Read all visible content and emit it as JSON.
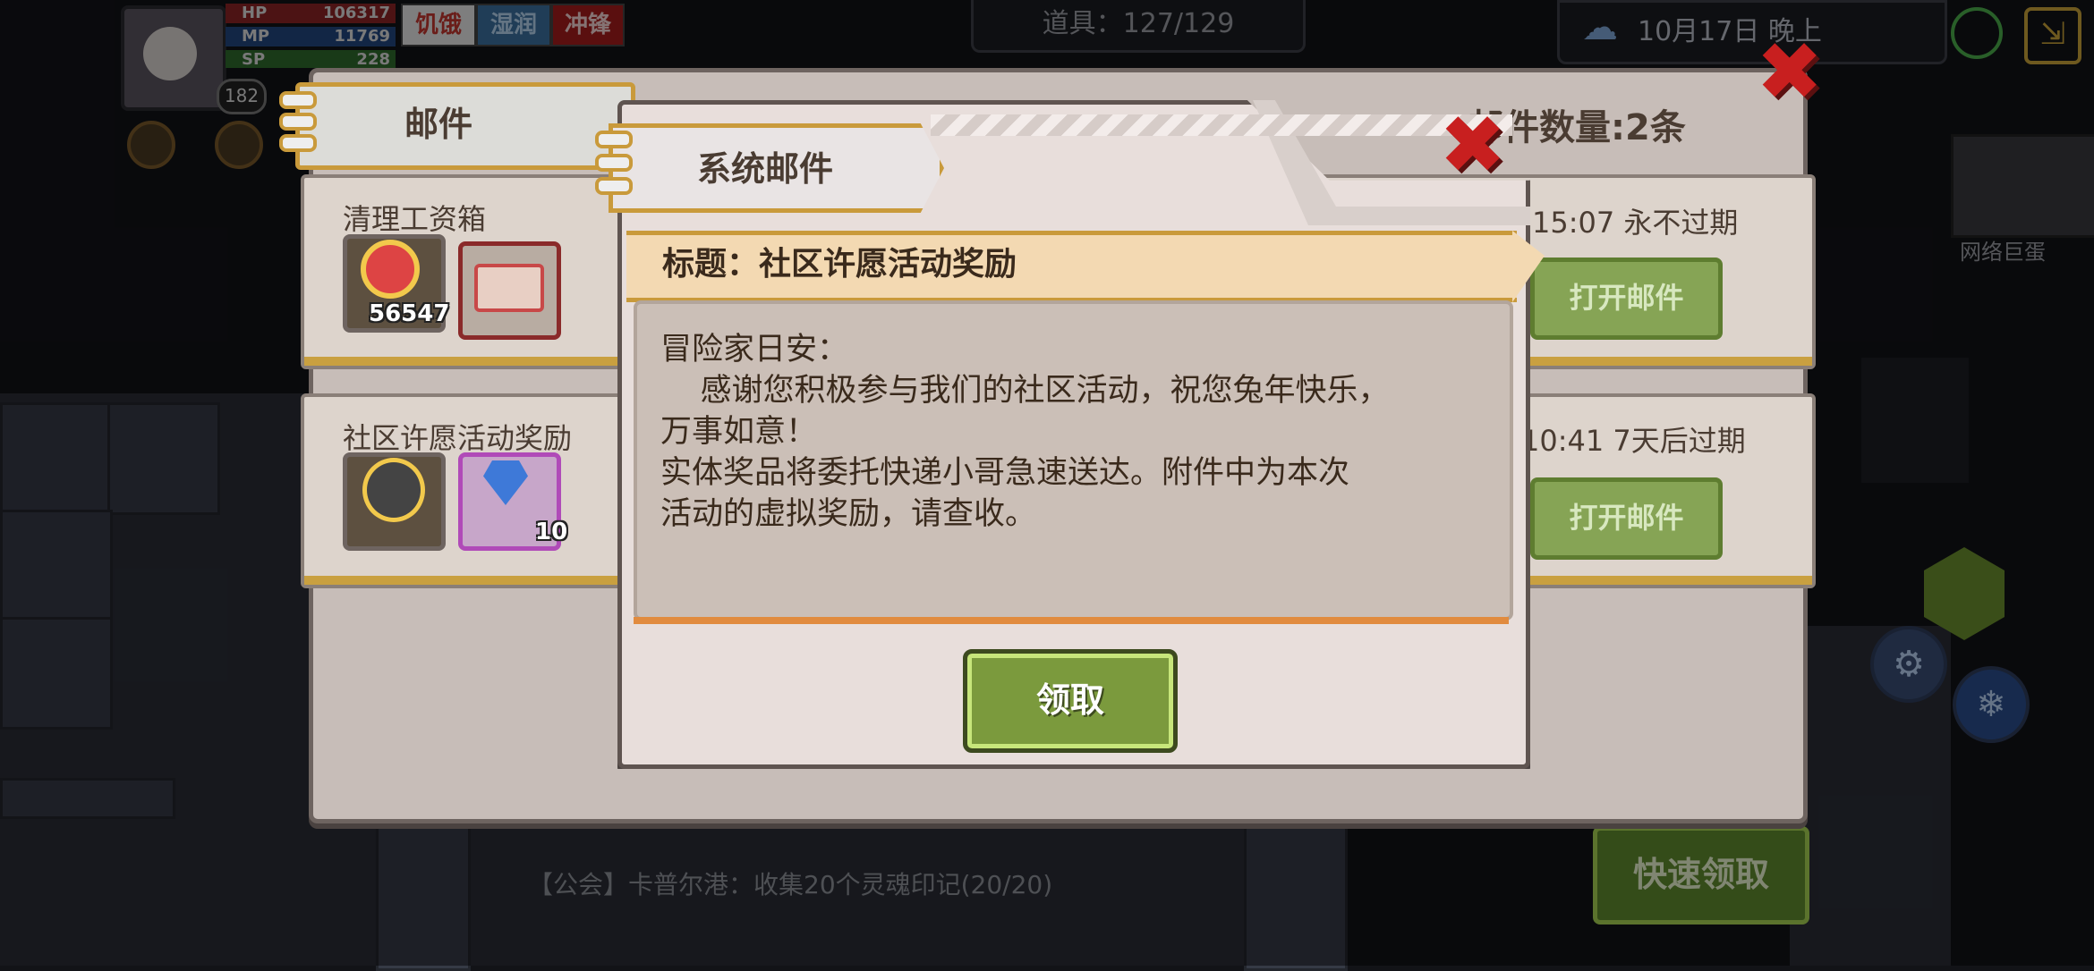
{
  "hud": {
    "hp_label": "HP",
    "hp_value": "106317",
    "mp_label": "MP",
    "mp_value": "11769",
    "sp_label": "SP",
    "sp_value": "228",
    "level": "182",
    "status_tags": [
      "饥饿",
      "湿润",
      "冲锋"
    ],
    "item_count": "道具：127/129",
    "date": "10月17日  晚上",
    "map_label": "网络巨蛋"
  },
  "chat": {
    "guild_message": "【公会】卡普尔港：收集20个灵魂印记(20/20)"
  },
  "mailbox": {
    "tab_label": "邮件",
    "count_label": "邮件数量:2条",
    "mails": [
      {
        "title": "清理工资箱",
        "time": "15:07  永不过期",
        "attachment_qty": "56547",
        "open_label": "打开邮件"
      },
      {
        "title": "社区许愿活动奖励",
        "time": "10:41  7天后过期",
        "attachment_qty": "10",
        "open_label": "打开邮件"
      }
    ]
  },
  "system_mail": {
    "tab_label": "系统邮件",
    "title": "标题：社区许愿活动奖励",
    "body": "冒险家日安：\n    感谢您积极参与我们的社区活动，祝您兔年快乐，\n万事如意！\n实体奖品将委托快递小哥急速送达。附件中为本次\n活动的虚拟奖励，请查收。",
    "claim_label": "领取"
  },
  "quick_claim_label": "快速领取",
  "colors": {
    "close_red": "#c81f1f",
    "gold_border": "#c99a3b",
    "button_green": "#7b9a3d",
    "ribbon": "#f3d9b2",
    "underline_orange": "#e18b3f"
  }
}
